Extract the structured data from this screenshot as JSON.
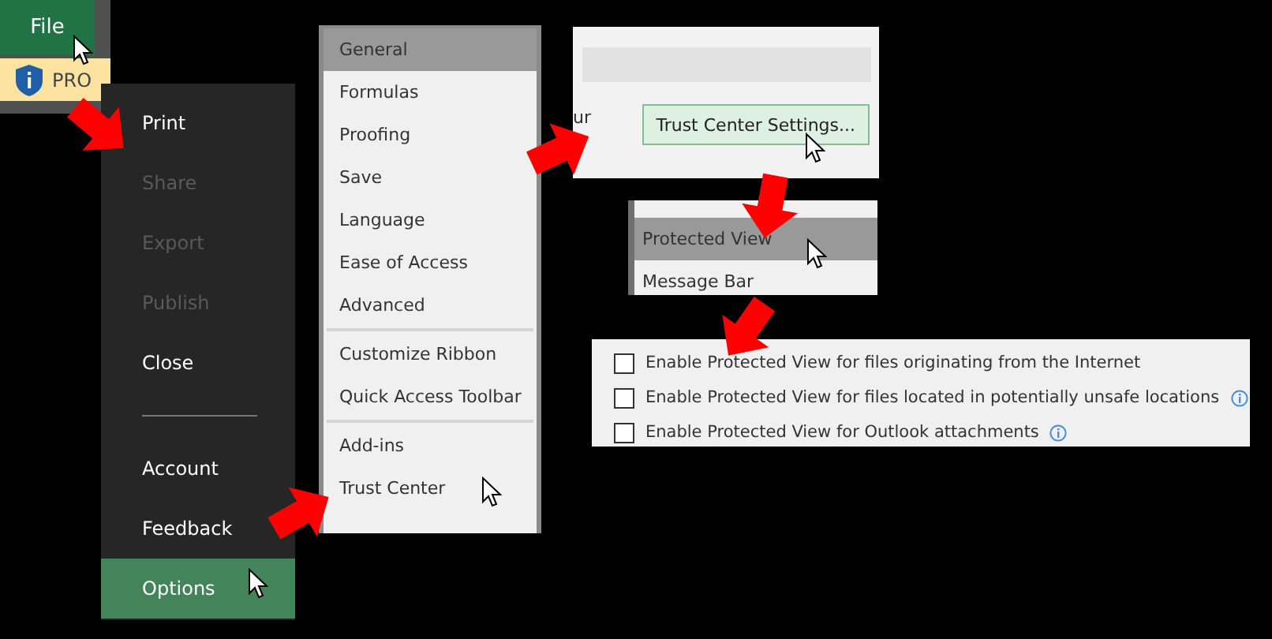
{
  "file_tab": {
    "label": "File"
  },
  "info_bar": {
    "text": "PRO"
  },
  "backstage": {
    "groups": [
      [
        {
          "label": "Print",
          "disabled": false,
          "selected": false
        },
        {
          "label": "Share",
          "disabled": true,
          "selected": false
        },
        {
          "label": "Export",
          "disabled": true,
          "selected": false
        },
        {
          "label": "Publish",
          "disabled": true,
          "selected": false
        },
        {
          "label": "Close",
          "disabled": false,
          "selected": false
        }
      ],
      [
        {
          "label": "Account",
          "disabled": false,
          "selected": false
        },
        {
          "label": "Feedback",
          "disabled": false,
          "selected": false
        },
        {
          "label": "Options",
          "disabled": false,
          "selected": true
        }
      ]
    ]
  },
  "options_nav": {
    "groups": [
      [
        {
          "label": "General",
          "selected": true
        },
        {
          "label": "Formulas",
          "selected": false
        },
        {
          "label": "Proofing",
          "selected": false
        },
        {
          "label": "Save",
          "selected": false
        },
        {
          "label": "Language",
          "selected": false
        },
        {
          "label": "Ease of Access",
          "selected": false
        },
        {
          "label": "Advanced",
          "selected": false
        }
      ],
      [
        {
          "label": "Customize Ribbon",
          "selected": false
        },
        {
          "label": "Quick Access Toolbar",
          "selected": false
        }
      ],
      [
        {
          "label": "Add-ins",
          "selected": false
        },
        {
          "label": "Trust Center",
          "selected": false
        }
      ]
    ]
  },
  "trust_center_page": {
    "text_fragment": "ur",
    "button": "Trust Center Settings..."
  },
  "trust_center_nav": {
    "items": [
      {
        "label": "Protected View",
        "selected": true
      },
      {
        "label": "Message Bar",
        "selected": false
      }
    ]
  },
  "protected_view": {
    "options": [
      {
        "label": "Enable Protected View for files originating from the Internet",
        "checked": false,
        "info": false
      },
      {
        "label": "Enable Protected View for files located in potentially unsafe locations",
        "checked": false,
        "info": true
      },
      {
        "label": "Enable Protected View for Outlook attachments",
        "checked": false,
        "info": true
      }
    ]
  }
}
